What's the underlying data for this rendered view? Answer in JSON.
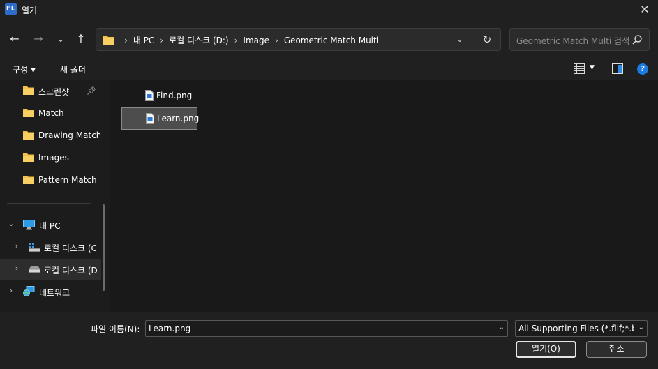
{
  "window": {
    "app_logo_text": "FL",
    "title": "열기"
  },
  "address_bar": {
    "crumbs": [
      "내 PC",
      "로컬 디스크 (D:)",
      "Image",
      "Geometric Match Multi"
    ]
  },
  "search": {
    "placeholder": "Geometric Match Multi 검색"
  },
  "command_bar": {
    "organize_label": "구성",
    "new_folder_label": "새 폴더"
  },
  "nav_pane": {
    "quick_access": [
      {
        "label": "스크린샷",
        "pinned": true
      },
      {
        "label": "Match"
      },
      {
        "label": "Drawing Match"
      },
      {
        "label": "Images"
      },
      {
        "label": "Pattern Match S"
      }
    ],
    "this_pc": {
      "label": "내 PC",
      "drives": [
        {
          "label": "로컬 디스크 (C"
        },
        {
          "label": "로컬 디스크 (D"
        }
      ]
    },
    "network": {
      "label": "네트워크"
    }
  },
  "files": [
    {
      "name": "Find.png",
      "selected": false
    },
    {
      "name": "Learn.png",
      "selected": true
    }
  ],
  "bottom": {
    "filename_label": "파일 이름(N):",
    "filename_value": "Learn.png",
    "filetype_value": "All Supporting Files (*.flif;*.bm",
    "open_label": "열기(O)",
    "cancel_label": "취소"
  },
  "colors": {
    "background": "#191919",
    "chrome": "#202020",
    "folder_yellow": "#f4c14a",
    "help_blue": "#1a7be0",
    "file_blue": "#2b7bd6"
  }
}
